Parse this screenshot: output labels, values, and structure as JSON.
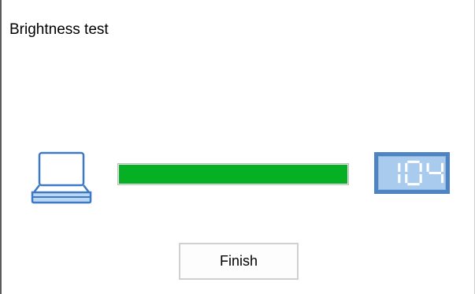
{
  "window": {
    "title": "Brightness test"
  },
  "brightness": {
    "progress_percent": 100,
    "value": "104",
    "laptop_icon": "laptop-icon",
    "colors": {
      "progress_fill": "#06b025",
      "display_frame": "#4f84c2",
      "display_face": "#a9cbee",
      "display_digits": "#ffffff"
    }
  },
  "actions": {
    "finish_label": "Finish"
  }
}
